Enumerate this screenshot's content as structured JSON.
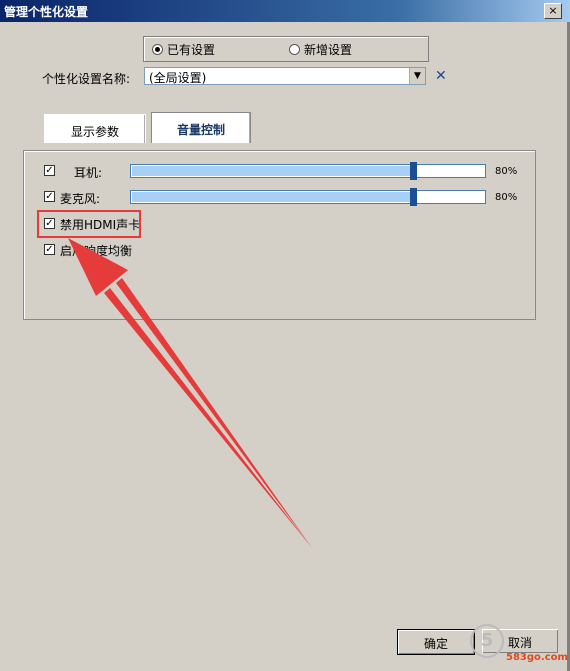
{
  "window": {
    "title": "管理个性化设置",
    "close_label": "×"
  },
  "mode": {
    "existing": "已有设置",
    "new": "新增设置",
    "selected": "existing"
  },
  "name_field": {
    "label": "个性化设置名称:",
    "value": "(全局设置)"
  },
  "tabs": [
    {
      "label": "显示参数",
      "active": false
    },
    {
      "label": "音量控制",
      "active": true
    }
  ],
  "volume": {
    "headphone": {
      "label": "耳机:",
      "checked": true,
      "level": 0.8,
      "value_text": "80%"
    },
    "microphone": {
      "label": "麦克风:",
      "checked": true,
      "level": 0.8,
      "value_text": "80%"
    },
    "disable_hdmi": {
      "label": "禁用HDMI声卡",
      "checked": true
    },
    "loudness": {
      "label": "启用响度均衡",
      "checked": true
    }
  },
  "buttons": {
    "ok": "确定",
    "cancel": "取消"
  },
  "watermark": {
    "logo_glyph": "5",
    "site": "583go.com"
  },
  "colors": {
    "highlight": "#e53b3b",
    "slider_fill": "#a6d0f5",
    "thumb": "#1c4e94"
  }
}
